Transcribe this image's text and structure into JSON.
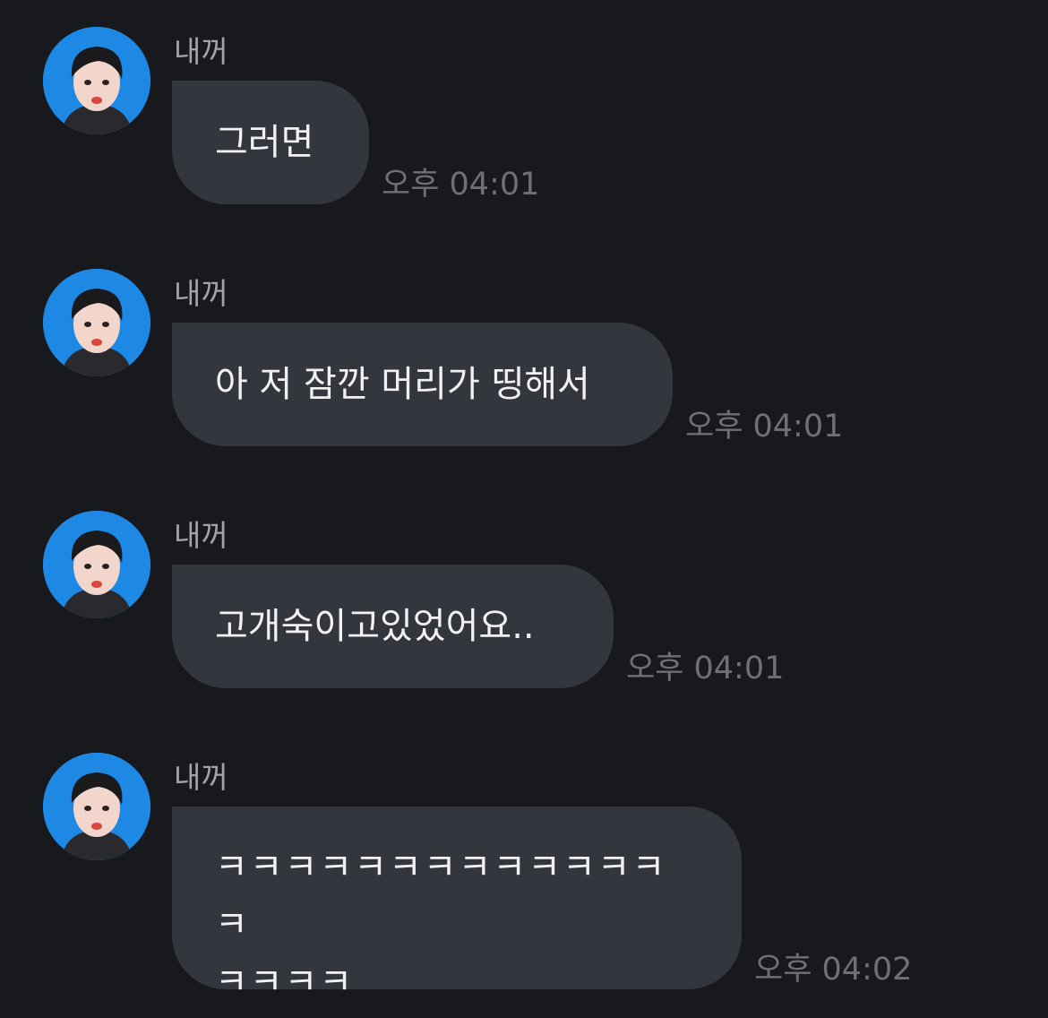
{
  "colors": {
    "background": "#18191d",
    "bubble": "#33363d",
    "bubble_text": "#f1f1f3",
    "sender_text": "#a3a4a8",
    "time_text": "#6f7075",
    "avatar_bg": "#1e88e5"
  },
  "messages": [
    {
      "sender": "내꺼",
      "text": "그러면",
      "time": "오후 04:01",
      "avatar": "profile-photo"
    },
    {
      "sender": "내꺼",
      "text": "아 저 잠깐 머리가 띵해서",
      "time": "오후 04:01",
      "avatar": "profile-photo"
    },
    {
      "sender": "내꺼",
      "text": "고개숙이고있었어요..",
      "time": "오후 04:01",
      "avatar": "profile-photo"
    },
    {
      "sender": "내꺼",
      "text": "ㅋㅋㅋㅋㅋㅋㅋㅋㅋㅋㅋㅋㅋㅋ\nㅋㅋㅋㅋ",
      "time": "오후 04:02",
      "avatar": "profile-photo"
    }
  ]
}
